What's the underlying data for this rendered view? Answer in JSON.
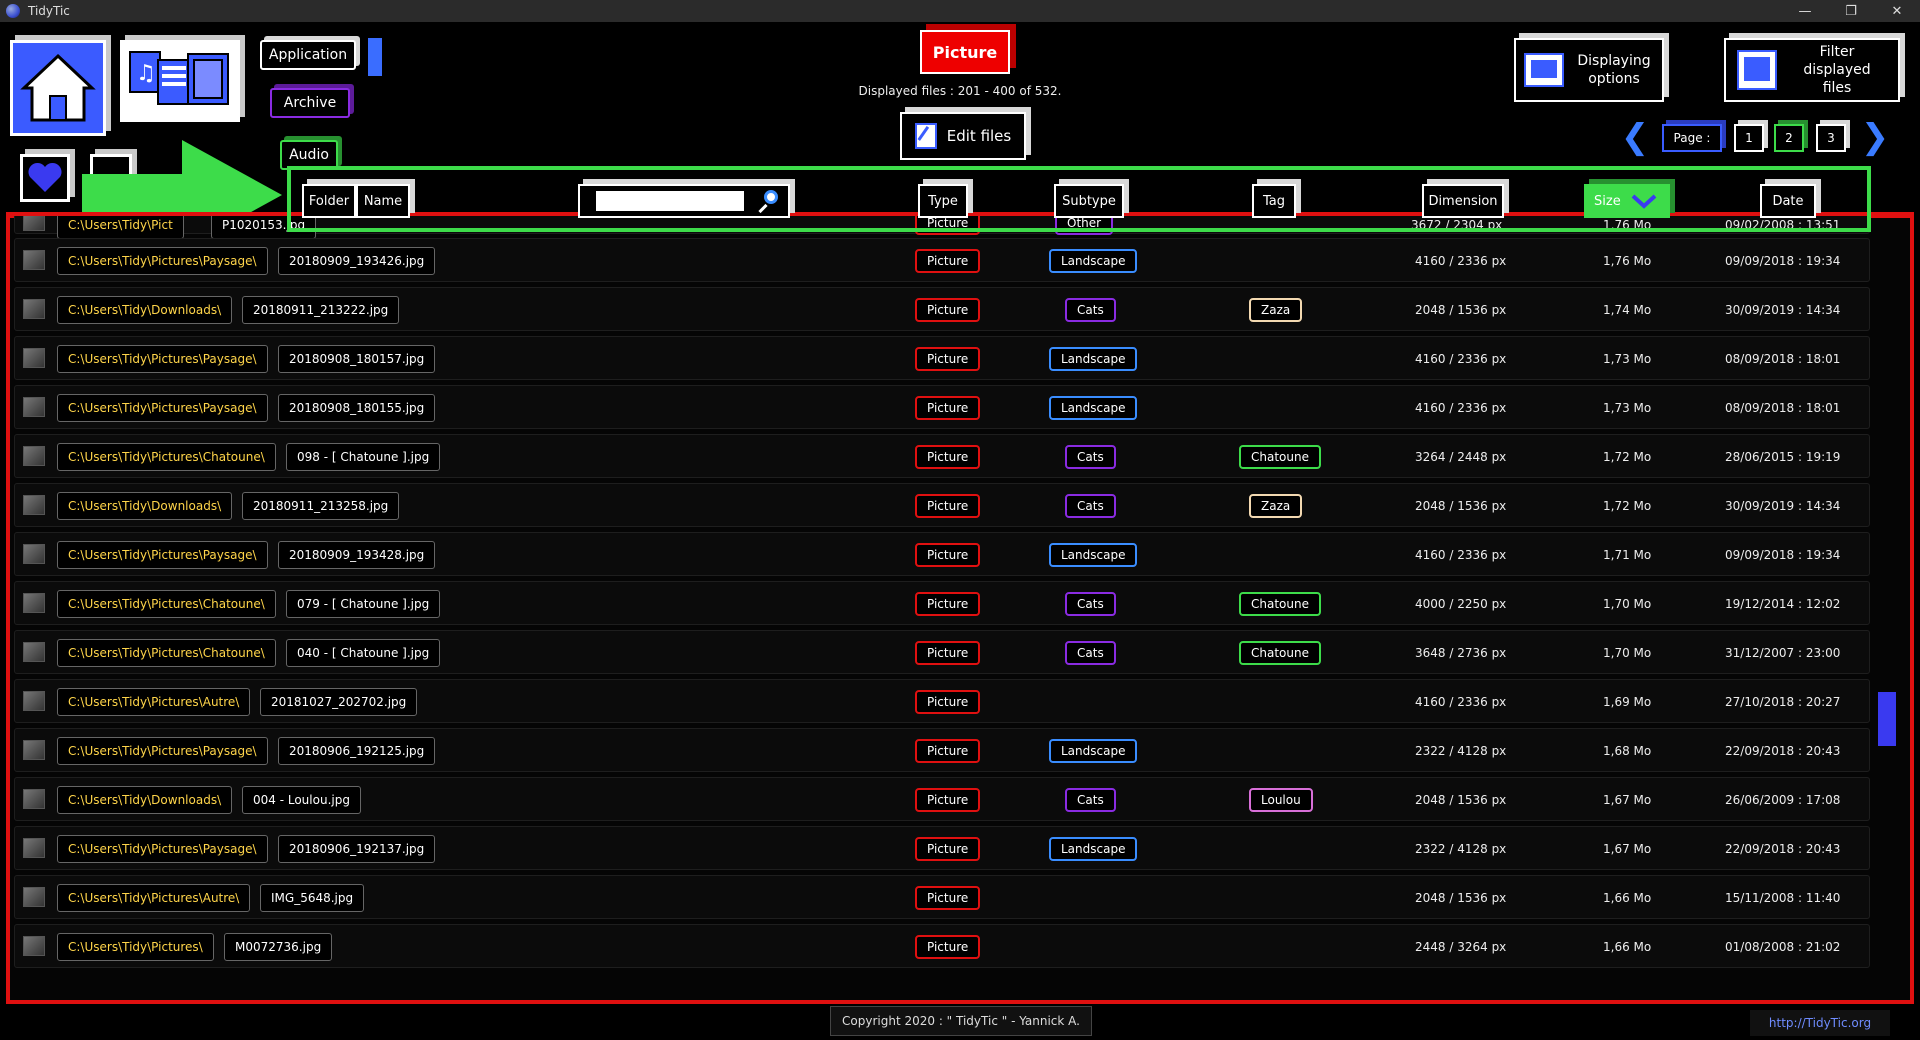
{
  "window": {
    "title": "TidyTic",
    "min": "—",
    "max": "❐",
    "close": "✕"
  },
  "type_buttons": [
    {
      "label": "Application",
      "color": "#3a6dff"
    },
    {
      "label": "Archive",
      "color": "#8a2be2"
    },
    {
      "label": "Audio",
      "color": "#3ddc4a"
    }
  ],
  "header": {
    "type_badge": "Picture",
    "displayed_info": "Displayed files : 201 - 400 of 532.",
    "edit_files": "Edit files",
    "displaying_options": "Displaying options",
    "filter_files": "Filter displayed files"
  },
  "pagination": {
    "label": "Page :",
    "pages": [
      "1",
      "2",
      "3"
    ],
    "current": "2",
    "prev": "❮",
    "next": "❯"
  },
  "columns": {
    "folder": "Folder",
    "name": "Name",
    "search_placeholder": "",
    "type": "Type",
    "subtype": "Subtype",
    "tag": "Tag",
    "dimension": "Dimension",
    "size": "Size",
    "date": "Date"
  },
  "colors": {
    "picture": "#e01010",
    "landscape": "#3a8dff",
    "cats": "#8a2be2",
    "zaza": "#f3d9b1",
    "chatoune": "#3ddc4a",
    "loulou": "#d86fd8",
    "folder_text": "#ffd54a"
  },
  "partial_row": {
    "folder": "C:\\Users\\Tidy\\Pict",
    "name": "P1020153.jpg",
    "type": "Picture",
    "subtype": "Other",
    "dimension": "3672 / 2304 px",
    "size": "1,76 Mo",
    "date": "09/02/2008 : 13:51"
  },
  "rows": [
    {
      "folder": "C:\\Users\\Tidy\\Pictures\\Paysage\\",
      "name": "20180909_193426.jpg",
      "type": "Picture",
      "subtype": "Landscape",
      "tag": "",
      "dimension": "4160 / 2336 px",
      "size": "1,76 Mo",
      "date": "09/09/2018 : 19:34"
    },
    {
      "folder": "C:\\Users\\Tidy\\Downloads\\",
      "name": "20180911_213222.jpg",
      "type": "Picture",
      "subtype": "Cats",
      "tag": "Zaza",
      "dimension": "2048 / 1536 px",
      "size": "1,74 Mo",
      "date": "30/09/2019 : 14:34"
    },
    {
      "folder": "C:\\Users\\Tidy\\Pictures\\Paysage\\",
      "name": "20180908_180157.jpg",
      "type": "Picture",
      "subtype": "Landscape",
      "tag": "",
      "dimension": "4160 / 2336 px",
      "size": "1,73 Mo",
      "date": "08/09/2018 : 18:01"
    },
    {
      "folder": "C:\\Users\\Tidy\\Pictures\\Paysage\\",
      "name": "20180908_180155.jpg",
      "type": "Picture",
      "subtype": "Landscape",
      "tag": "",
      "dimension": "4160 / 2336 px",
      "size": "1,73 Mo",
      "date": "08/09/2018 : 18:01"
    },
    {
      "folder": "C:\\Users\\Tidy\\Pictures\\Chatoune\\",
      "name": "098 - [ Chatoune ].jpg",
      "type": "Picture",
      "subtype": "Cats",
      "tag": "Chatoune",
      "dimension": "3264 / 2448 px",
      "size": "1,72 Mo",
      "date": "28/06/2015 : 19:19"
    },
    {
      "folder": "C:\\Users\\Tidy\\Downloads\\",
      "name": "20180911_213258.jpg",
      "type": "Picture",
      "subtype": "Cats",
      "tag": "Zaza",
      "dimension": "2048 / 1536 px",
      "size": "1,72 Mo",
      "date": "30/09/2019 : 14:34"
    },
    {
      "folder": "C:\\Users\\Tidy\\Pictures\\Paysage\\",
      "name": "20180909_193428.jpg",
      "type": "Picture",
      "subtype": "Landscape",
      "tag": "",
      "dimension": "4160 / 2336 px",
      "size": "1,71 Mo",
      "date": "09/09/2018 : 19:34"
    },
    {
      "folder": "C:\\Users\\Tidy\\Pictures\\Chatoune\\",
      "name": "079 - [ Chatoune ].jpg",
      "type": "Picture",
      "subtype": "Cats",
      "tag": "Chatoune",
      "dimension": "4000 / 2250 px",
      "size": "1,70 Mo",
      "date": "19/12/2014 : 12:02"
    },
    {
      "folder": "C:\\Users\\Tidy\\Pictures\\Chatoune\\",
      "name": "040 - [ Chatoune ].jpg",
      "type": "Picture",
      "subtype": "Cats",
      "tag": "Chatoune",
      "dimension": "3648 / 2736 px",
      "size": "1,70 Mo",
      "date": "31/12/2007 : 23:00"
    },
    {
      "folder": "C:\\Users\\Tidy\\Pictures\\Autre\\",
      "name": "20181027_202702.jpg",
      "type": "Picture",
      "subtype": "",
      "tag": "",
      "dimension": "4160 / 2336 px",
      "size": "1,69 Mo",
      "date": "27/10/2018 : 20:27"
    },
    {
      "folder": "C:\\Users\\Tidy\\Pictures\\Paysage\\",
      "name": "20180906_192125.jpg",
      "type": "Picture",
      "subtype": "Landscape",
      "tag": "",
      "dimension": "2322 / 4128 px",
      "size": "1,68 Mo",
      "date": "22/09/2018 : 20:43"
    },
    {
      "folder": "C:\\Users\\Tidy\\Downloads\\",
      "name": "004 - Loulou.jpg",
      "type": "Picture",
      "subtype": "Cats",
      "tag": "Loulou",
      "dimension": "2048 / 1536 px",
      "size": "1,67 Mo",
      "date": "26/06/2009 : 17:08"
    },
    {
      "folder": "C:\\Users\\Tidy\\Pictures\\Paysage\\",
      "name": "20180906_192137.jpg",
      "type": "Picture",
      "subtype": "Landscape",
      "tag": "",
      "dimension": "2322 / 4128 px",
      "size": "1,67 Mo",
      "date": "22/09/2018 : 20:43"
    },
    {
      "folder": "C:\\Users\\Tidy\\Pictures\\Autre\\",
      "name": "IMG_5648.jpg",
      "type": "Picture",
      "subtype": "",
      "tag": "",
      "dimension": "2048 / 1536 px",
      "size": "1,66 Mo",
      "date": "15/11/2008 : 11:40"
    },
    {
      "folder": "C:\\Users\\Tidy\\Pictures\\",
      "name": "M0072736.jpg",
      "type": "Picture",
      "subtype": "",
      "tag": "",
      "dimension": "2448 / 3264 px",
      "size": "1,66 Mo",
      "date": "01/08/2008 : 21:02"
    }
  ],
  "footer": {
    "copyright": "Copyright 2020 : \" TidyTic \" - Yannick A.",
    "link": "http://TidyTic.org"
  }
}
